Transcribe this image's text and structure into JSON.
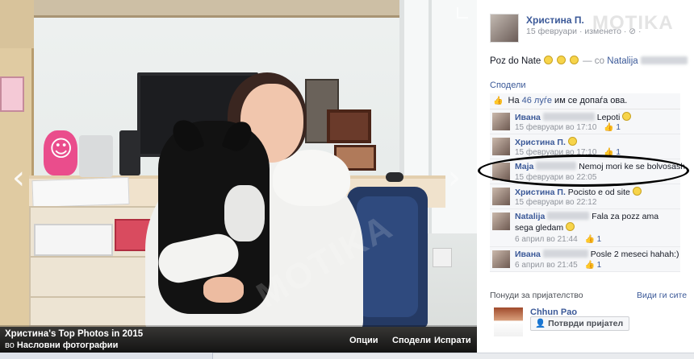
{
  "watermark": "MOTIKA",
  "photo_watermark": "MOTIKA",
  "photo": {
    "album_title": "Христина's Top Photos in 2015",
    "album_sub_prefix": "во",
    "album_sub_name": "Насловни фотографии",
    "actions": {
      "options": "Опции",
      "share": "Сподели",
      "send": "Испрати"
    },
    "arrow_prev": "‹",
    "arrow_next": "›"
  },
  "post": {
    "author": "Христина П.",
    "meta": "15 февруари · изменето · ⊘ ·",
    "text_prefix": "Poz do Nate",
    "text_with": "— со",
    "tagged": "Natalija",
    "share_label": "Сподели",
    "likes_prefix": "На",
    "likes_count": "46 луѓе",
    "likes_suffix": "им се допаѓа ова."
  },
  "comments": [
    {
      "author": "Ивана",
      "text": "Lepoti",
      "smiley": true,
      "time": "15 февруари во 17:10",
      "likes": "1"
    },
    {
      "author": "Христина П.",
      "text": "",
      "smiley": true,
      "time": "15 февруари во 17:10",
      "likes": "1"
    },
    {
      "author": "Maja",
      "text": "Nemoj mori ke se bolvosash",
      "smiley": false,
      "time": "15 февруари во 22:05",
      "likes": ""
    },
    {
      "author": "Христина П.",
      "text": "Pocisto e od site",
      "smiley": true,
      "time": "15 февруари во 22:12",
      "likes": ""
    },
    {
      "author": "Natalija",
      "text": "Fala za pozz ama sega gledam",
      "smiley": true,
      "time": "6 април во 21:44",
      "likes": "1"
    },
    {
      "author": "Ивана",
      "text": "Posle 2 meseci hahah:)",
      "smiley": false,
      "time": "6 април во 21:45",
      "likes": "1"
    }
  ],
  "suggestions": {
    "label": "Понуди за пријателство",
    "see_all": "Види ги сите",
    "person_name": "Chhun Pao",
    "confirm_label": "Потврди пријател"
  },
  "icons": {
    "like": "thumb-up-icon",
    "add_friend": "add-friend-icon",
    "expand": "expand-icon"
  }
}
